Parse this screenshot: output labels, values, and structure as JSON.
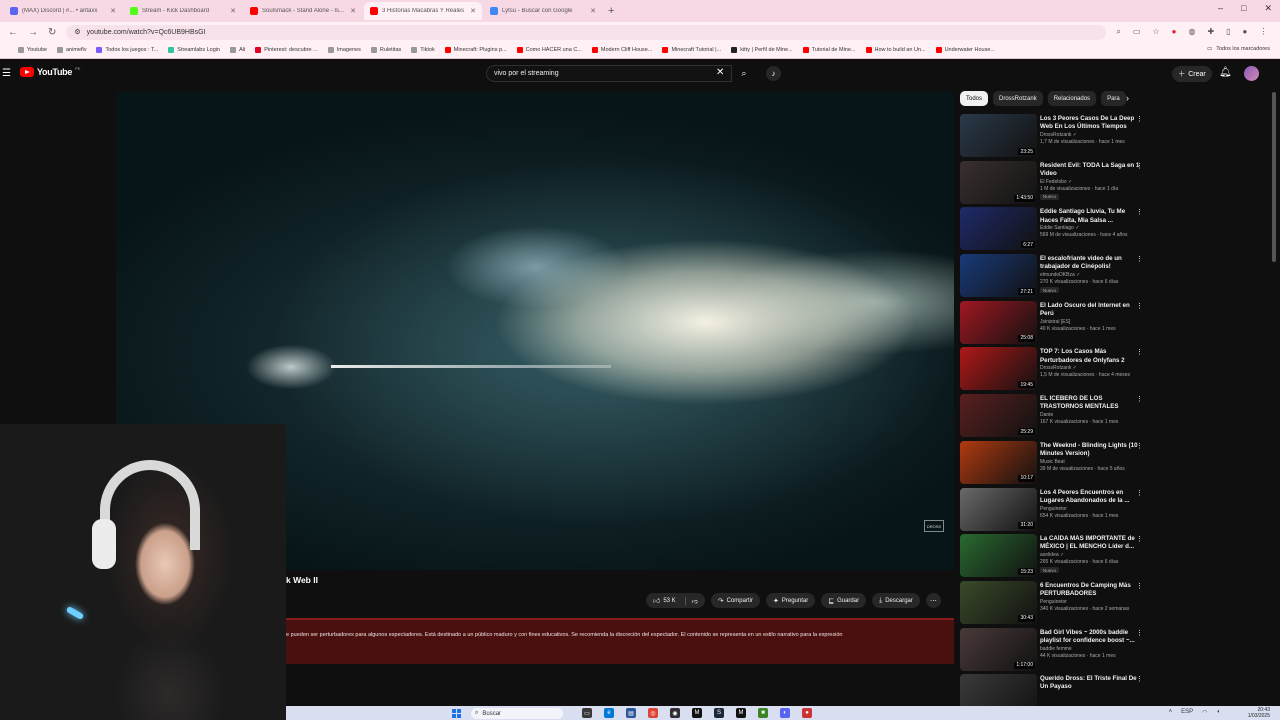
{
  "browser": {
    "tabs": [
      {
        "title": "(MAX) Discord | #... • aritaxx",
        "color": "#5865f2",
        "active": false
      },
      {
        "title": "Stream - Kick Dashboard",
        "color": "#53fc18",
        "active": false
      },
      {
        "title": "Soulsmack - Stand Alone - Is...",
        "color": "#ff0000",
        "active": false
      },
      {
        "title": "3 Historias Macabras Y Reales ...",
        "color": "#ff0000",
        "active": true
      },
      {
        "title": "Lytsu - Buscar con Google",
        "color": "#4285f4",
        "active": false
      }
    ],
    "new_tab_symbol": "+",
    "window_controls": [
      "–",
      "□",
      "✕"
    ],
    "url": "youtube.com/watch?v=Qc6UB9HBsGI",
    "bookmarks": [
      {
        "label": "Youtube",
        "color": "#999"
      },
      {
        "label": "animeflv",
        "color": "#999"
      },
      {
        "label": "Todos los juegos : T...",
        "color": "#7b5cff"
      },
      {
        "label": "Streamlabs Login",
        "color": "#31c3a2"
      },
      {
        "label": "Ali",
        "color": "#999"
      },
      {
        "label": "Pinterest: descubre ...",
        "color": "#e60023"
      },
      {
        "label": "Imagenes",
        "color": "#999"
      },
      {
        "label": "Ruletitas",
        "color": "#999"
      },
      {
        "label": "Tiktok",
        "color": "#999"
      },
      {
        "label": "Minecraft: Plugins p...",
        "color": "#ff0000"
      },
      {
        "label": "Como HACER una C...",
        "color": "#ff0000"
      },
      {
        "label": "Modern Cliff House...",
        "color": "#ff0000"
      },
      {
        "label": "Minecraft Tutorial |...",
        "color": "#ff0000"
      },
      {
        "label": "kitty | Perfil de Mine...",
        "color": "#222"
      },
      {
        "label": "Tutorial de Mine...",
        "color": "#ff0000"
      },
      {
        "label": "How to build an Un...",
        "color": "#ff0000"
      },
      {
        "label": "Underwater House...",
        "color": "#ff0000"
      }
    ],
    "bookmarks_right": "Todos los marcadores"
  },
  "youtube": {
    "logo_text": "YouTube",
    "country_code": "PE",
    "search_value": "vivo por el streaming",
    "create_label": "Crear"
  },
  "video": {
    "title_fragment": "k Web II",
    "actions": {
      "likes": "53 K",
      "share": "Compartir",
      "ask": "Preguntar",
      "save": "Guardar",
      "download": "Descargar"
    },
    "warning": "e pueden ser perturbadores para algunos espectadores. Está destinado a un público maduro y con fines educativos.  Se recomienda la discreción del espectador.  El contenido se representa en un estilo narrativo para la expresión",
    "watermark": "DROSS"
  },
  "chips": [
    "Todos",
    "DrossRotzank",
    "Relacionados",
    "Para"
  ],
  "recommendations": [
    {
      "title": "Los 3 Peores Casos De La Deep Web En Los Últimos Tiempos",
      "channel": "DrossRotzank ✓",
      "meta": "1,7 M de visualizaciones · hace 1 mes",
      "badge": "",
      "duration": "23:25",
      "thumb": "#2b3a4a"
    },
    {
      "title": "Resident Evil: TODA La Saga en 1 Video",
      "channel": "El Fedelobo ✓",
      "meta": "1 M de visualizaciones · hace 1 día",
      "badge": "Nuevo",
      "duration": "1:43:50",
      "thumb": "#3a3030"
    },
    {
      "title": "Eddie Santiago   Lluvia, Tu Me Haces Falta, Mia Salsa ...",
      "channel": "Eddie Santiago ✓",
      "meta": "569 M de visualizaciones · hace 4 años",
      "badge": "",
      "duration": "6:27",
      "thumb": "#1f2a6a"
    },
    {
      "title": "El escalofriante video de un trabajador de Cinépolis!",
      "channel": "elmundoDKBza ✓",
      "meta": "270 K visualizaciones · hace 6 días",
      "badge": "Nuevo",
      "duration": "27:21",
      "thumb": "#1a3a7a"
    },
    {
      "title": "El Lado Oscuro del Internet en Perú",
      "channel": "Jsinistral [ES]",
      "meta": "40 K visualizaciones · hace 1 mes",
      "badge": "",
      "duration": "25:08",
      "thumb": "#a01822"
    },
    {
      "title": "TOP 7: Los Casos Más Perturbadores de Onlyfans 2",
      "channel": "DrossRotzank ✓",
      "meta": "1,5 M de visualizaciones · hace 4 meses",
      "badge": "",
      "duration": "19:45",
      "thumb": "#b01818"
    },
    {
      "title": "EL ICEBERG DE LOS TRASTORNOS MENTALES",
      "channel": "Dante",
      "meta": "167 K visualizaciones · hace 1 mes",
      "badge": "",
      "duration": "25:29",
      "thumb": "#5a2020"
    },
    {
      "title": "The Weeknd - Blinding Lights (10 Minutes Version)",
      "channel": "Music Beat",
      "meta": "39 M de visualizaciones · hace 5 años",
      "badge": "",
      "duration": "10:17",
      "thumb": "#b03a10"
    },
    {
      "title": "Los 4 Peores Encuentros en Lugares Abandonados de la ...",
      "channel": "Penguinetor",
      "meta": "654 K visualizaciones · hace 1 mes",
      "badge": "",
      "duration": "31:20",
      "thumb": "#6a6a6a"
    },
    {
      "title": "La CAÍDA MÁS IMPORTANTE de MÉXICO | EL MENCHO Líder d...",
      "channel": "axelidea ✓",
      "meta": "265 K visualizaciones · hace 6 días",
      "badge": "Nuevo",
      "duration": "15:23",
      "thumb": "#2a6a30"
    },
    {
      "title": "6 Encuentros De Camping Más PERTURBADORES",
      "channel": "Penguinetor",
      "meta": "340 K visualizaciones · hace 2 semanas",
      "badge": "",
      "duration": "30:43",
      "thumb": "#3a4a2a"
    },
    {
      "title": "Bad Girl Vibes ~ 2000s baddie playlist for confidence boost ~...",
      "channel": "baddie femme",
      "meta": "44 K visualizaciones · hace 1 mes",
      "badge": "",
      "duration": "1:17:00",
      "thumb": "#4a3a3a"
    },
    {
      "title": "Querido Dross: El Triste Final De Un Payaso",
      "channel": "",
      "meta": "",
      "badge": "",
      "duration": "",
      "thumb": "#3a3a3a"
    }
  ],
  "taskbar": {
    "search_placeholder": "Buscar",
    "lang": "ESP",
    "time": "20:43",
    "date": "1/03/2025"
  },
  "icons": {
    "menu": "☰",
    "close": "✕",
    "search": "⌕",
    "mic": "🎤",
    "bell": "🔔",
    "like": "👍",
    "dislike": "👎",
    "share": "↷",
    "ask": "✦",
    "save": "⊑",
    "download": "⤓",
    "more": "⋯",
    "kebab": "⋮",
    "chevron_right": "›"
  }
}
